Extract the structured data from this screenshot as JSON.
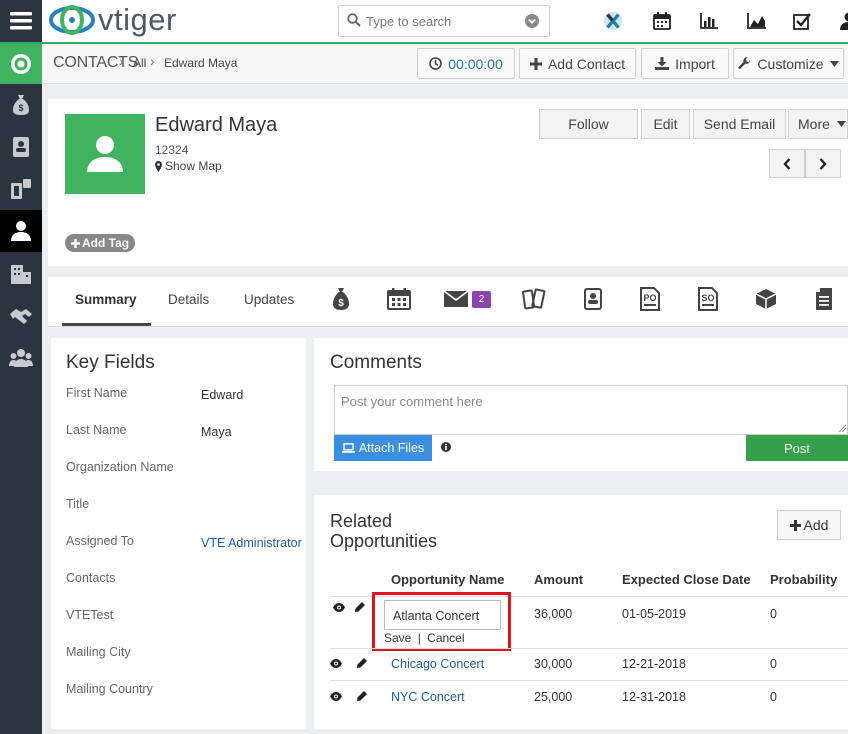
{
  "app": {
    "logo_text": "vtiger"
  },
  "search": {
    "placeholder": "Type to search"
  },
  "header": {
    "module": "CONTACTS",
    "breadcrumb_all": "All",
    "breadcrumb_record": "Edward Maya",
    "timer": "00:00:00",
    "add_contact": "Add Contact",
    "import": "Import",
    "customize": "Customize"
  },
  "record": {
    "name": "Edward Maya",
    "number": "12324",
    "show_map": "Show Map",
    "add_tag": "Add Tag",
    "actions": {
      "follow": "Follow",
      "edit": "Edit",
      "send_email": "Send Email",
      "more": "More"
    }
  },
  "tabs": {
    "summary": "Summary",
    "details": "Details",
    "updates": "Updates",
    "email_badge": "2"
  },
  "key_fields": {
    "title": "Key Fields",
    "rows": [
      {
        "label": "First Name",
        "value": "Edward"
      },
      {
        "label": "Last Name",
        "value": "Maya"
      },
      {
        "label": "Organization Name",
        "value": ""
      },
      {
        "label": "Title",
        "value": ""
      },
      {
        "label": "Assigned To",
        "value": "VTE Administrator"
      },
      {
        "label": "Contacts",
        "value": ""
      },
      {
        "label": "VTETest",
        "value": ""
      },
      {
        "label": "Mailing City",
        "value": ""
      },
      {
        "label": "Mailing Country",
        "value": ""
      }
    ]
  },
  "comments": {
    "title": "Comments",
    "placeholder": "Post your comment here",
    "attach_files": "Attach Files",
    "post": "Post"
  },
  "related": {
    "title": "Related Opportunities",
    "add": "Add",
    "columns": [
      "Opportunity Name",
      "Amount",
      "Expected Close Date",
      "Probability"
    ],
    "editing_value": "Atlanta Concert",
    "save": "Save",
    "separator": "|",
    "cancel": "Cancel",
    "rows": [
      {
        "name": "Atlanta Concert",
        "amount": "36,000",
        "close_date": "01-05-2019",
        "probability": "0"
      },
      {
        "name": "Chicago Concert",
        "amount": "30,000",
        "close_date": "12-21-2018",
        "probability": "0"
      },
      {
        "name": "NYC Concert",
        "amount": "25,000",
        "close_date": "12-31-2018",
        "probability": "0"
      }
    ]
  },
  "colors": {
    "accent_green": "#3fb360",
    "link_blue": "#1f5aa6",
    "attach_blue": "#3b8fe0",
    "post_green": "#35a14a",
    "sidebar": "#2b343f",
    "highlight_red": "#e0141e",
    "badge_purple": "#8e44ad"
  }
}
